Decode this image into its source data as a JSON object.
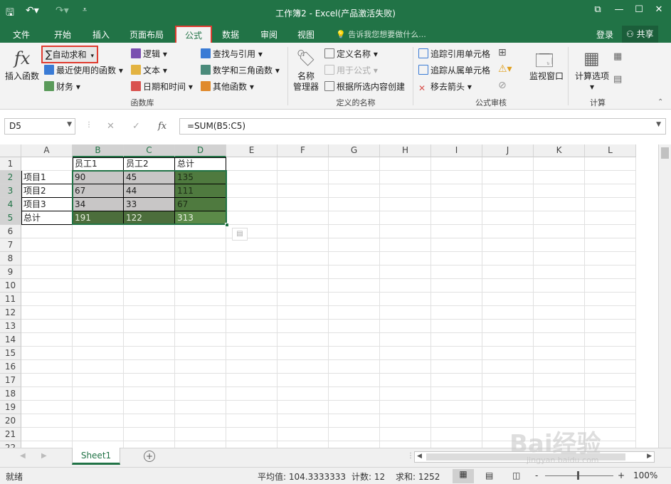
{
  "titlebar": {
    "title": "工作簿2 - Excel(产品激活失败)",
    "save_icon": "save-icon",
    "undo_icon": "undo-icon",
    "redo_icon": "redo-icon",
    "customize_icon": "customize-quick-access-icon",
    "bg_color": "#217346"
  },
  "tabs": {
    "file": "文件",
    "home": "开始",
    "insert": "插入",
    "page_layout": "页面布局",
    "formulas": "公式",
    "data": "数据",
    "review": "审阅",
    "view": "视图",
    "tell_me": "告诉我您想要做什么...",
    "signin": "登录",
    "share": "共享"
  },
  "ribbon": {
    "insert_function": "插入函数",
    "fx": "fx",
    "autosum": "自动求和",
    "recent": "最近使用的函数",
    "financial": "财务",
    "logical": "逻辑",
    "text": "文本",
    "datetime": "日期和时间",
    "lookup": "查找与引用",
    "math": "数学和三角函数",
    "more": "其他函数",
    "group_library": "函数库",
    "name_manager_1": "名称",
    "name_manager_2": "管理器",
    "define_name": "定义名称",
    "use_in_formula": "用于公式",
    "create_from_selection": "根据所选内容创建",
    "group_names": "定义的名称",
    "trace_precedents": "追踪引用单元格",
    "trace_dependents": "追踪从属单元格",
    "remove_arrows": "移去箭头",
    "group_audit": "公式审核",
    "watch_window": "监视窗口",
    "calc_options": "计算选项",
    "group_calc": "计算"
  },
  "formula_bar": {
    "name_box": "D5",
    "formula": "=SUM(B5:C5)",
    "fx": "fx"
  },
  "columns": [
    "A",
    "B",
    "C",
    "D",
    "E",
    "F",
    "G",
    "H",
    "I",
    "J",
    "K",
    "L"
  ],
  "rows": [
    "1",
    "2",
    "3",
    "4",
    "5",
    "6",
    "7",
    "8",
    "9",
    "10",
    "11",
    "12",
    "13",
    "14",
    "15",
    "16",
    "17",
    "18",
    "19",
    "20",
    "21",
    "22"
  ],
  "cells": {
    "B1": "员工1",
    "C1": "员工2",
    "D1": "总计",
    "A2": "项目1",
    "B2": "90",
    "C2": "45",
    "D2": "135",
    "A3": "项目2",
    "B3": "67",
    "C3": "44",
    "D3": "111",
    "A4": "项目3",
    "B4": "34",
    "C4": "33",
    "D4": "67",
    "A5": "总计",
    "B5": "191",
    "C5": "122",
    "D5": "313"
  },
  "sheet_tabs": [
    "Sheet1"
  ],
  "status": {
    "ready": "就绪",
    "average": "平均值: 104.3333333",
    "count": "计数: 12",
    "sum": "求和: 1252",
    "zoom": "100%",
    "zoom_minus": "-",
    "zoom_plus": "+"
  },
  "watermark": {
    "text": "Bai经验",
    "url": "jingyan.baidu.com"
  }
}
